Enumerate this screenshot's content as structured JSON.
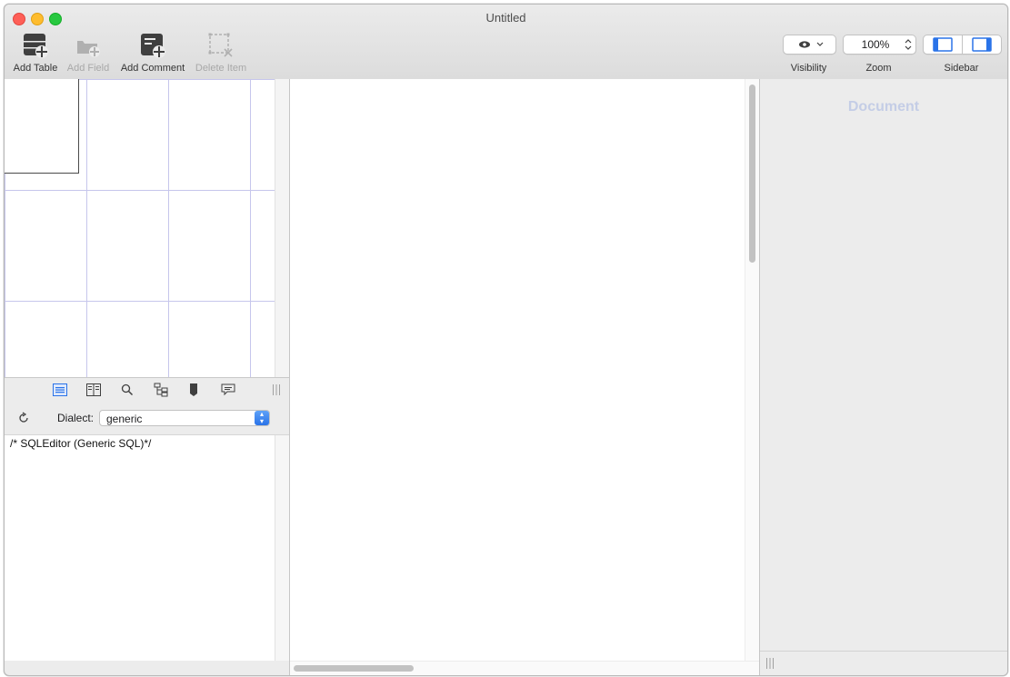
{
  "window": {
    "title": "Untitled"
  },
  "toolbar": {
    "add_table": "Add Table",
    "add_field": "Add Field",
    "add_comment": "Add Comment",
    "delete_item": "Delete Item",
    "visibility_label": "Visibility",
    "zoom_label": "Zoom",
    "zoom_value": "100%",
    "sidebar_label": "Sidebar"
  },
  "inspector": {
    "dialect_label": "Dialect:",
    "dialect_value": "generic",
    "sql_text": "/* SQLEditor (Generic SQL)*/"
  },
  "sidebar": {
    "title": "Document"
  },
  "colors": {
    "accent": "#2a73e8",
    "grid": "#c6c6ec",
    "sidebar_title": "#c4cde6"
  }
}
